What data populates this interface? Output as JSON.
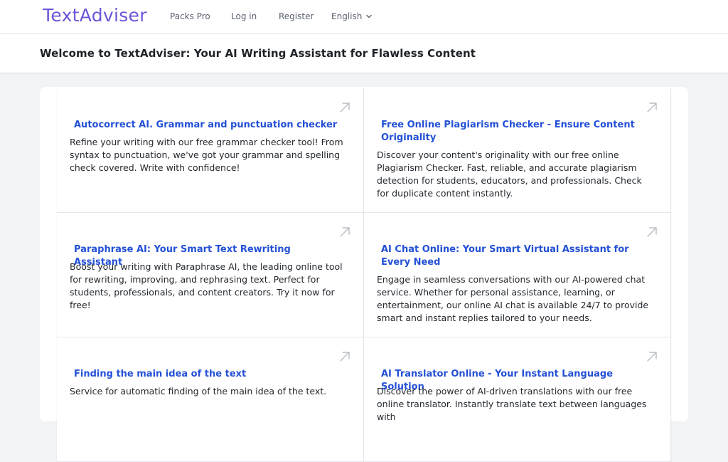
{
  "header": {
    "logo": "TextAdviser",
    "nav": {
      "packs": "Packs Pro",
      "login": "Log in",
      "register": "Register",
      "language": "English"
    }
  },
  "page": {
    "title": "Welcome to TextAdviser: Your AI Writing Assistant for Flawless Content"
  },
  "cards": [
    {
      "title": "Autocorrect AI. Grammar and punctuation checker",
      "description": "Refine your writing with our free grammar checker tool! From syntax to punctuation, we've got your grammar and spelling check covered. Write with confidence!"
    },
    {
      "title": "Free Online Plagiarism Checker - Ensure Content Originality",
      "description": "Discover your content's originality with our free online Plagiarism Checker. Fast, reliable, and accurate plagiarism detection for students, educators, and professionals. Check for duplicate content instantly."
    },
    {
      "title": "Paraphrase AI: Your Smart Text Rewriting Assistant",
      "description": "Boost your writing with Paraphrase AI, the leading online tool for rewriting, improving, and rephrasing text. Perfect for students, professionals, and content creators. Try it now for free!"
    },
    {
      "title": "AI Chat Online: Your Smart Virtual Assistant for Every Need",
      "description": "Engage in seamless conversations with our AI-powered chat service. Whether for personal assistance, learning, or entertainment, our online AI chat is available 24/7 to provide smart and instant replies tailored to your needs."
    },
    {
      "title": "Finding the main idea of the text",
      "description": "Service for automatic finding of the main idea of the text."
    },
    {
      "title": "AI Translator Online - Your Instant Language Solution",
      "description": "Discover the power of AI-driven translations with our free online translator. Instantly translate text between languages with"
    }
  ],
  "icons": {
    "card_link": "arrow-up-right-icon",
    "language_dropdown": "chevron-down-icon"
  },
  "colors": {
    "logo": "#6c55d9",
    "link": "#2350d6",
    "background": "#f2f3f5"
  }
}
